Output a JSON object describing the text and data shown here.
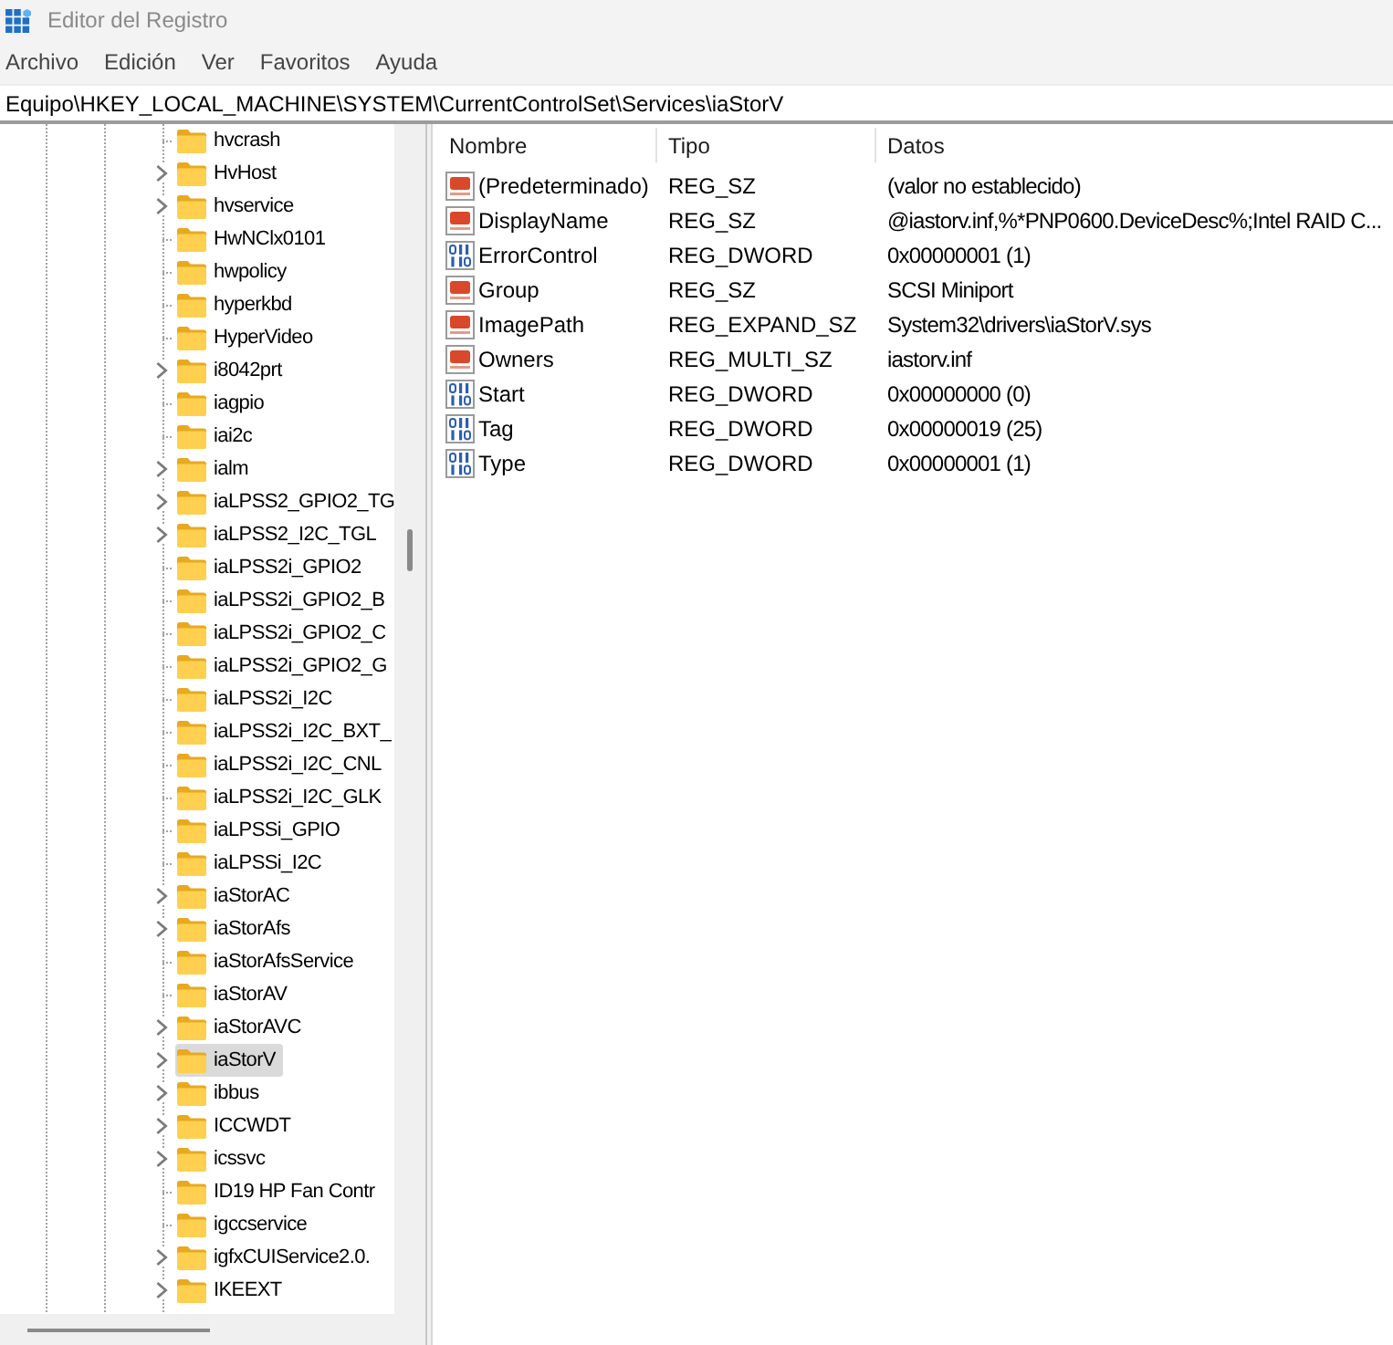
{
  "window": {
    "title": "Editor del Registro"
  },
  "menu": [
    "Archivo",
    "Edición",
    "Ver",
    "Favoritos",
    "Ayuda"
  ],
  "address_bar": {
    "value": "Equipo\\HKEY_LOCAL_MACHINE\\SYSTEM\\CurrentControlSet\\Services\\iaStorV"
  },
  "tree": {
    "items": [
      {
        "label": "hvcrash",
        "expandable": false,
        "selected": false
      },
      {
        "label": "HvHost",
        "expandable": true,
        "selected": false
      },
      {
        "label": "hvservice",
        "expandable": true,
        "selected": false
      },
      {
        "label": "HwNClx0101",
        "expandable": false,
        "selected": false
      },
      {
        "label": "hwpolicy",
        "expandable": false,
        "selected": false
      },
      {
        "label": "hyperkbd",
        "expandable": false,
        "selected": false
      },
      {
        "label": "HyperVideo",
        "expandable": false,
        "selected": false
      },
      {
        "label": "i8042prt",
        "expandable": true,
        "selected": false
      },
      {
        "label": "iagpio",
        "expandable": false,
        "selected": false
      },
      {
        "label": "iai2c",
        "expandable": false,
        "selected": false
      },
      {
        "label": "ialm",
        "expandable": true,
        "selected": false
      },
      {
        "label": "iaLPSS2_GPIO2_TG",
        "expandable": true,
        "selected": false
      },
      {
        "label": "iaLPSS2_I2C_TGL",
        "expandable": true,
        "selected": false
      },
      {
        "label": "iaLPSS2i_GPIO2",
        "expandable": false,
        "selected": false
      },
      {
        "label": "iaLPSS2i_GPIO2_B",
        "expandable": false,
        "selected": false
      },
      {
        "label": "iaLPSS2i_GPIO2_C",
        "expandable": false,
        "selected": false
      },
      {
        "label": "iaLPSS2i_GPIO2_G",
        "expandable": false,
        "selected": false
      },
      {
        "label": "iaLPSS2i_I2C",
        "expandable": false,
        "selected": false
      },
      {
        "label": "iaLPSS2i_I2C_BXT_",
        "expandable": false,
        "selected": false
      },
      {
        "label": "iaLPSS2i_I2C_CNL",
        "expandable": false,
        "selected": false
      },
      {
        "label": "iaLPSS2i_I2C_GLK",
        "expandable": false,
        "selected": false
      },
      {
        "label": "iaLPSSi_GPIO",
        "expandable": false,
        "selected": false
      },
      {
        "label": "iaLPSSi_I2C",
        "expandable": false,
        "selected": false
      },
      {
        "label": "iaStorAC",
        "expandable": true,
        "selected": false
      },
      {
        "label": "iaStorAfs",
        "expandable": true,
        "selected": false
      },
      {
        "label": "iaStorAfsService",
        "expandable": false,
        "selected": false
      },
      {
        "label": "iaStorAV",
        "expandable": false,
        "selected": false
      },
      {
        "label": "iaStorAVC",
        "expandable": true,
        "selected": false
      },
      {
        "label": "iaStorV",
        "expandable": true,
        "selected": true
      },
      {
        "label": "ibbus",
        "expandable": true,
        "selected": false
      },
      {
        "label": "ICCWDT",
        "expandable": true,
        "selected": false
      },
      {
        "label": "icssvc",
        "expandable": true,
        "selected": false
      },
      {
        "label": "ID19 HP Fan Contr",
        "expandable": false,
        "selected": false
      },
      {
        "label": "igccservice",
        "expandable": false,
        "selected": false
      },
      {
        "label": "igfxCUIService2.0.",
        "expandable": true,
        "selected": false
      },
      {
        "label": "IKEEXT",
        "expandable": true,
        "selected": false
      }
    ]
  },
  "values": {
    "columns": [
      "Nombre",
      "Tipo",
      "Datos"
    ],
    "rows": [
      {
        "kind": "string",
        "name": "(Predeterminado)",
        "type": "REG_SZ",
        "data": "(valor no establecido)",
        "selected": false
      },
      {
        "kind": "string",
        "name": "DisplayName",
        "type": "REG_SZ",
        "data": "@iastorv.inf,%*PNP0600.DeviceDesc%;Intel RAID C...",
        "selected": false
      },
      {
        "kind": "binary",
        "name": "ErrorControl",
        "type": "REG_DWORD",
        "data": "0x00000001 (1)",
        "selected": false
      },
      {
        "kind": "string",
        "name": "Group",
        "type": "REG_SZ",
        "data": "SCSI Miniport",
        "selected": false
      },
      {
        "kind": "string",
        "name": "ImagePath",
        "type": "REG_EXPAND_SZ",
        "data": "System32\\drivers\\iaStorV.sys",
        "selected": false
      },
      {
        "kind": "string",
        "name": "Owners",
        "type": "REG_MULTI_SZ",
        "data": "iastorv.inf",
        "selected": false
      },
      {
        "kind": "binary",
        "name": "Start",
        "type": "REG_DWORD",
        "data": "0x00000000 (0)",
        "selected": false
      },
      {
        "kind": "binary",
        "name": "Tag",
        "type": "REG_DWORD",
        "data": "0x00000019 (25)",
        "selected": false
      },
      {
        "kind": "binary",
        "name": "Type",
        "type": "REG_DWORD",
        "data": "0x00000001 (1)",
        "selected": false
      }
    ]
  }
}
